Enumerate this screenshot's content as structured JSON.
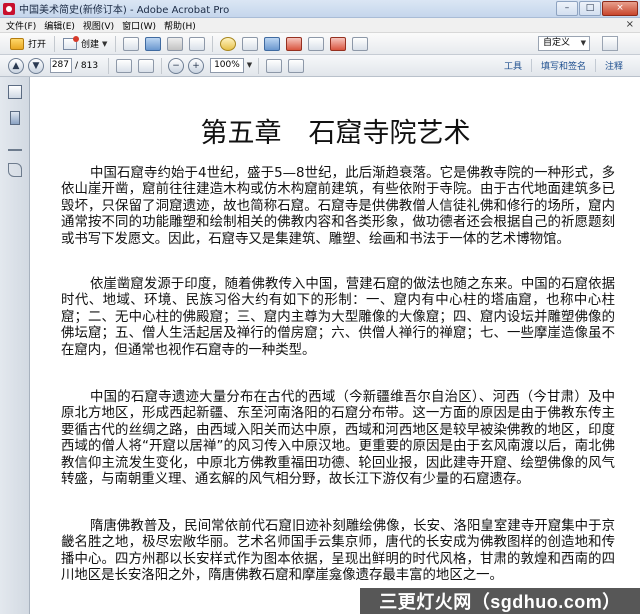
{
  "window": {
    "title": "中国美术简史(新修订本) - Adobe Acrobat Pro",
    "controls": {
      "minimize": "–",
      "maximize": "□",
      "close": "×"
    }
  },
  "menubar": {
    "items": [
      "文件(F)",
      "编辑(E)",
      "视图(V)",
      "窗口(W)",
      "帮助(H)"
    ],
    "close_glyph": "×"
  },
  "toolbar1": {
    "open_label": "打开",
    "create_label": "创建",
    "custom_label": "自定义"
  },
  "toolbar2": {
    "current_page": "287",
    "total_pages": "/ 813",
    "zoom": "100%",
    "right_tabs": [
      "工具",
      "填写和签名",
      "注释"
    ]
  },
  "document": {
    "chapter_title": "第五章　石窟寺院艺术",
    "paragraphs": [
      "中国石窟寺约始于4世纪，盛于5—8世纪，此后渐趋衰落。它是佛教寺院的一种形式，多依山崖开凿，窟前往往建造木构或仿木构窟前建筑，有些依附于寺院。由于古代地面建筑多已毁坏，只保留了洞窟遗迹，故也简称石窟。石窟寺是供佛教僧人信徒礼佛和修行的场所，窟内通常按不同的功能雕塑和绘制相关的佛教内容和各类形象，做功德者还会根据自己的祈愿题刻或书写下发愿文。因此，石窟寺又是集建筑、雕塑、绘画和书法于一体的艺术博物馆。",
      "依崖凿窟发源于印度，随着佛教传入中国，营建石窟的做法也随之东来。中国的石窟依据时代、地域、环境、民族习俗大约有如下的形制：一、窟内有中心柱的塔庙窟，也称中心柱窟；二、无中心柱的佛殿窟；三、窟内主尊为大型雕像的大像窟；四、窟内设坛并雕塑佛像的佛坛窟；五、僧人生活起居及禅行的僧房窟；六、供僧人禅行的禅窟；七、一些摩崖造像虽不在窟内，但通常也视作石窟寺的一种类型。",
      "中国的石窟寺遗迹大量分布在古代的西域（今新疆维吾尔自治区）、河西（今甘肃）及中原北方地区，形成西起新疆、东至河南洛阳的石窟分布带。这一方面的原因是由于佛教东传主要循古代的丝绸之路，由西域入阳关而达中原，西域和河西地区是较早被染佛教的地区，印度西域的僧人将“开窟以居禅”的风习传入中原汉地。更重要的原因是由于玄风南渡以后，南北佛教信仰主流发生变化，中原北方佛教重福田功德、轮回业报，因此建寺开窟、绘塑佛像的风气转盛，与南朝重义理、通玄解的风气相分野，故长江下游仅有少量的石窟遗存。",
      "隋唐佛教普及，民间常依前代石窟旧迹补刻雕绘佛像，长安、洛阳皇室建寺开窟集中于京畿名胜之地，极尽宏敞华丽。艺术名师国手云集京师，唐代的长安成为佛教图样的创造地和传播中心。四方州郡以长安样式作为图本依据，呈现出鲜明的时代风格，甘肃的敦煌和西南的四川地区是长安洛阳之外，隋唐佛教石窟和摩崖龛像遗存最丰富的地区之一。"
    ]
  },
  "watermark": {
    "text": "三更灯火网（sgdhuo.com）"
  }
}
